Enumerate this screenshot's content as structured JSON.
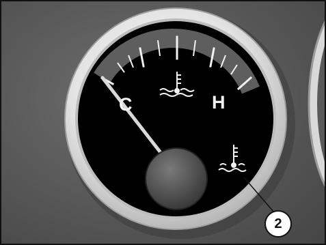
{
  "gauge": {
    "cold_label": "C",
    "hot_label": "H",
    "scale_icon": "coolant-temperature-icon",
    "warning_icon": "coolant-temperature-icon",
    "needle_level": 0.0
  },
  "callout": {
    "number": "2"
  },
  "colors": {
    "dial_face": "#000000",
    "scale_band": "#5e5e5e",
    "bezel": "#e6e6e6",
    "needle": "#d9d9d9",
    "markings": "#f2f2f2"
  }
}
